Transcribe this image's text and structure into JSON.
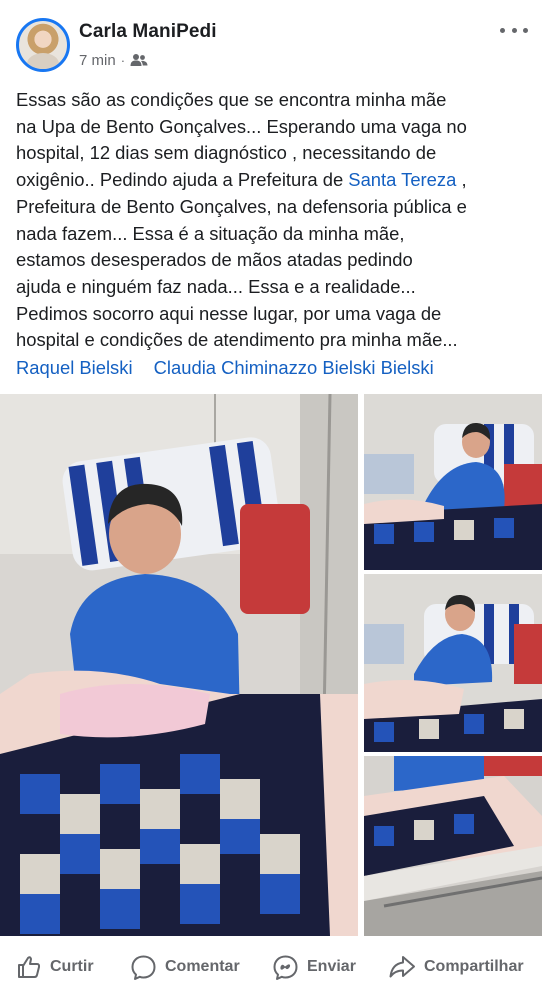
{
  "post": {
    "author": "Carla ManiPedi",
    "time": "7 min",
    "separator": "·",
    "audience_icon": "friends-icon",
    "more_icon": "more-dots-icon",
    "text_lines": [
      {
        "before": "Essas são as condições que se encontra minha mãe",
        "link": "",
        "after": ""
      },
      {
        "before": "na Upa de Bento Gonçalves... Esperando uma vaga no",
        "link": "",
        "after": ""
      },
      {
        "before": "hospital, 12 dias sem diagnóstico , necessitando de",
        "link": "",
        "after": ""
      },
      {
        "before": "oxigênio.. Pedindo ajuda a Prefeitura de ",
        "link": "Santa Tereza",
        "after": " ,"
      },
      {
        "before": "Prefeitura de Bento Gonçalves, na defensoria pública e",
        "link": "",
        "after": ""
      },
      {
        "before": "nada fazem... Essa é a situação da minha mãe,",
        "link": "",
        "after": ""
      },
      {
        "before": "estamos desesperados de mãos atadas pedindo",
        "link": "",
        "after": ""
      },
      {
        "before": "ajuda e ninguém faz nada... Essa e a realidade...",
        "link": "",
        "after": ""
      },
      {
        "before": "Pedimos socorro aqui nesse lugar, por uma vaga de",
        "link": "",
        "after": ""
      },
      {
        "before": "hospital e condições de atendimento pra minha mãe...",
        "link": "",
        "after": ""
      }
    ],
    "tags": [
      "Raquel Bielski",
      "Claudia Chiminazzo Bielski Bielski"
    ],
    "link_color": "#1460c2"
  },
  "photos": [
    {
      "id": "main",
      "subject": "woman-in-hospital-bed"
    },
    {
      "id": "thumb-1",
      "subject": "woman-in-hospital-bed"
    },
    {
      "id": "thumb-2",
      "subject": "woman-in-hospital-bed"
    },
    {
      "id": "thumb-3",
      "subject": "hospital-bed-close-up"
    }
  ],
  "actions": {
    "like": {
      "label": "Curtir",
      "icon": "like-icon"
    },
    "comment": {
      "label": "Comentar",
      "icon": "comment-icon"
    },
    "send": {
      "label": "Enviar",
      "icon": "messenger-icon"
    },
    "share": {
      "label": "Compartilhar",
      "icon": "share-icon"
    }
  },
  "colors": {
    "brand": "#1877f2",
    "secondary_text": "#65676b",
    "primary_text": "#1c1e21"
  }
}
